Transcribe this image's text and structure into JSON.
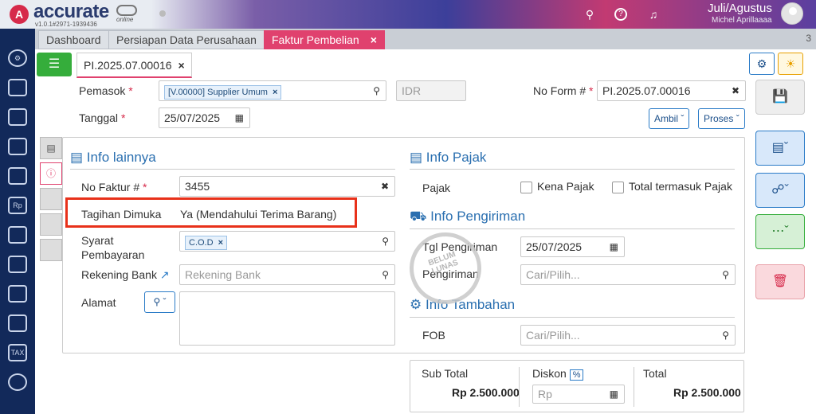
{
  "app": {
    "name": "accurate",
    "sub": "online",
    "version": "v1.0.1#2971-1939436"
  },
  "user": {
    "period": "Juli/Agustus",
    "name": "Michel Aprillaaaa"
  },
  "tabs": [
    {
      "label": "Dashboard"
    },
    {
      "label": "Persiapan Data Perusahaan"
    },
    {
      "label": "Faktur Pembelian",
      "close": "×"
    }
  ],
  "tab_count": "3",
  "doc_tab": {
    "label": "PI.2025.07.00016",
    "close": "×"
  },
  "header": {
    "pemasok_label": "Pemasok",
    "pemasok_chip": "[V.00000] Supplier Umum",
    "currency_placeholder": "IDR",
    "noform_label": "No Form #",
    "noform_value": "PI.2025.07.00016",
    "tanggal_label": "Tanggal",
    "tanggal_value": "25/07/2025",
    "ambil_label": "Ambil",
    "proses_label": "Proses",
    "req_mark": "*"
  },
  "info_lainnya": {
    "title": "Info lainnya",
    "no_faktur_label": "No Faktur #",
    "no_faktur_value": "3455",
    "tagihan_label": "Tagihan Dimuka",
    "tagihan_value": "Ya (Mendahului Terima Barang)",
    "syarat_label_1": "Syarat",
    "syarat_label_2": "Pembayaran",
    "syarat_chip": "C.O.D",
    "rekening_label": "Rekening Bank",
    "rekening_placeholder": "Rekening Bank",
    "alamat_label": "Alamat"
  },
  "info_pajak": {
    "title": "Info Pajak",
    "pajak_label": "Pajak",
    "kena_pajak": "Kena Pajak",
    "total_termasuk": "Total termasuk Pajak"
  },
  "info_pengiriman": {
    "title": "Info Pengiriman",
    "tgl_label": "Tgl Pengiriman",
    "tgl_value": "25/07/2025",
    "pengiriman_label": "Pengiriman",
    "pengiriman_placeholder": "Cari/Pilih..."
  },
  "info_tambahan": {
    "title": "Info Tambahan",
    "fob_label": "FOB",
    "fob_placeholder": "Cari/Pilih..."
  },
  "stamp": {
    "line1": "BELUM",
    "line2": "LUNAS"
  },
  "totals": {
    "subtotal_label": "Sub Total",
    "subtotal_value": "Rp 2.500.000",
    "diskon_label": "Diskon",
    "diskon_pct": "%",
    "diskon_prefix": "Rp",
    "total_label": "Total",
    "total_value": "Rp 2.500.000"
  }
}
